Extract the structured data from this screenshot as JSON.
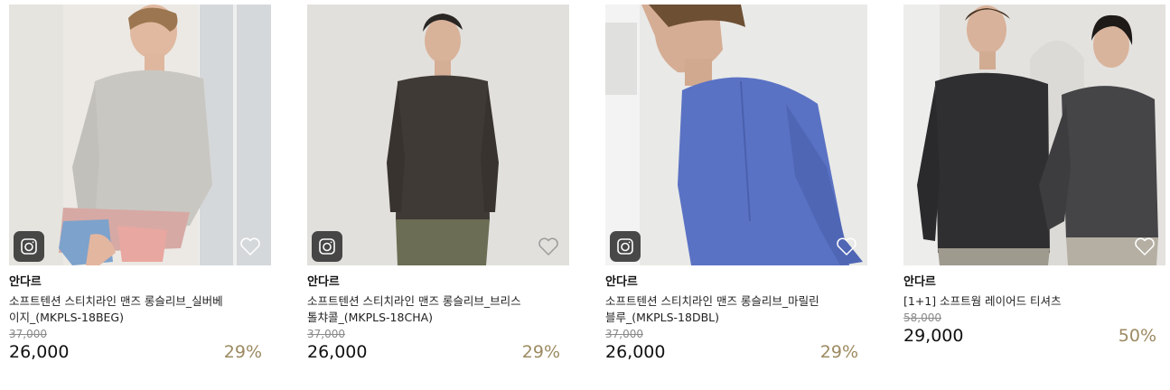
{
  "products": [
    {
      "brand": "안다르",
      "name_line1": "소프트텐션 스티치라인 맨즈 롱슬리브_실버베",
      "name_line2": "이지_(MKPLS-18BEG)",
      "original_price": "37,000",
      "price": "26,000",
      "discount": "29%",
      "has_photo_review": true,
      "shirt_color": "#c9c7c2"
    },
    {
      "brand": "안다르",
      "name_line1": "소프트텐션 스티치라인 맨즈 롱슬리브_브리스",
      "name_line2": "톨챠콜_(MKPLS-18CHA)",
      "original_price": "37,000",
      "price": "26,000",
      "discount": "29%",
      "has_photo_review": true,
      "shirt_color": "#3f3a36"
    },
    {
      "brand": "안다르",
      "name_line1": "소프트텐션 스티치라인 맨즈 롱슬리브_마릴린",
      "name_line2": "블루_(MKPLS-18DBL)",
      "original_price": "37,000",
      "price": "26,000",
      "discount": "29%",
      "has_photo_review": true,
      "shirt_color": "#5a72c4"
    },
    {
      "brand": "안다르",
      "name_line1": "[1+1] 소프트웜 레이어드 티셔츠",
      "name_line2": "",
      "original_price": "58,000",
      "price": "29,000",
      "discount": "50%",
      "has_photo_review": false,
      "shirt_color": "#2f2f31"
    }
  ],
  "icons": {
    "review": "camera-icon",
    "wishlist": "heart-icon"
  },
  "colors": {
    "discount": "#9c8a61",
    "badge": "#3a3a3a"
  }
}
